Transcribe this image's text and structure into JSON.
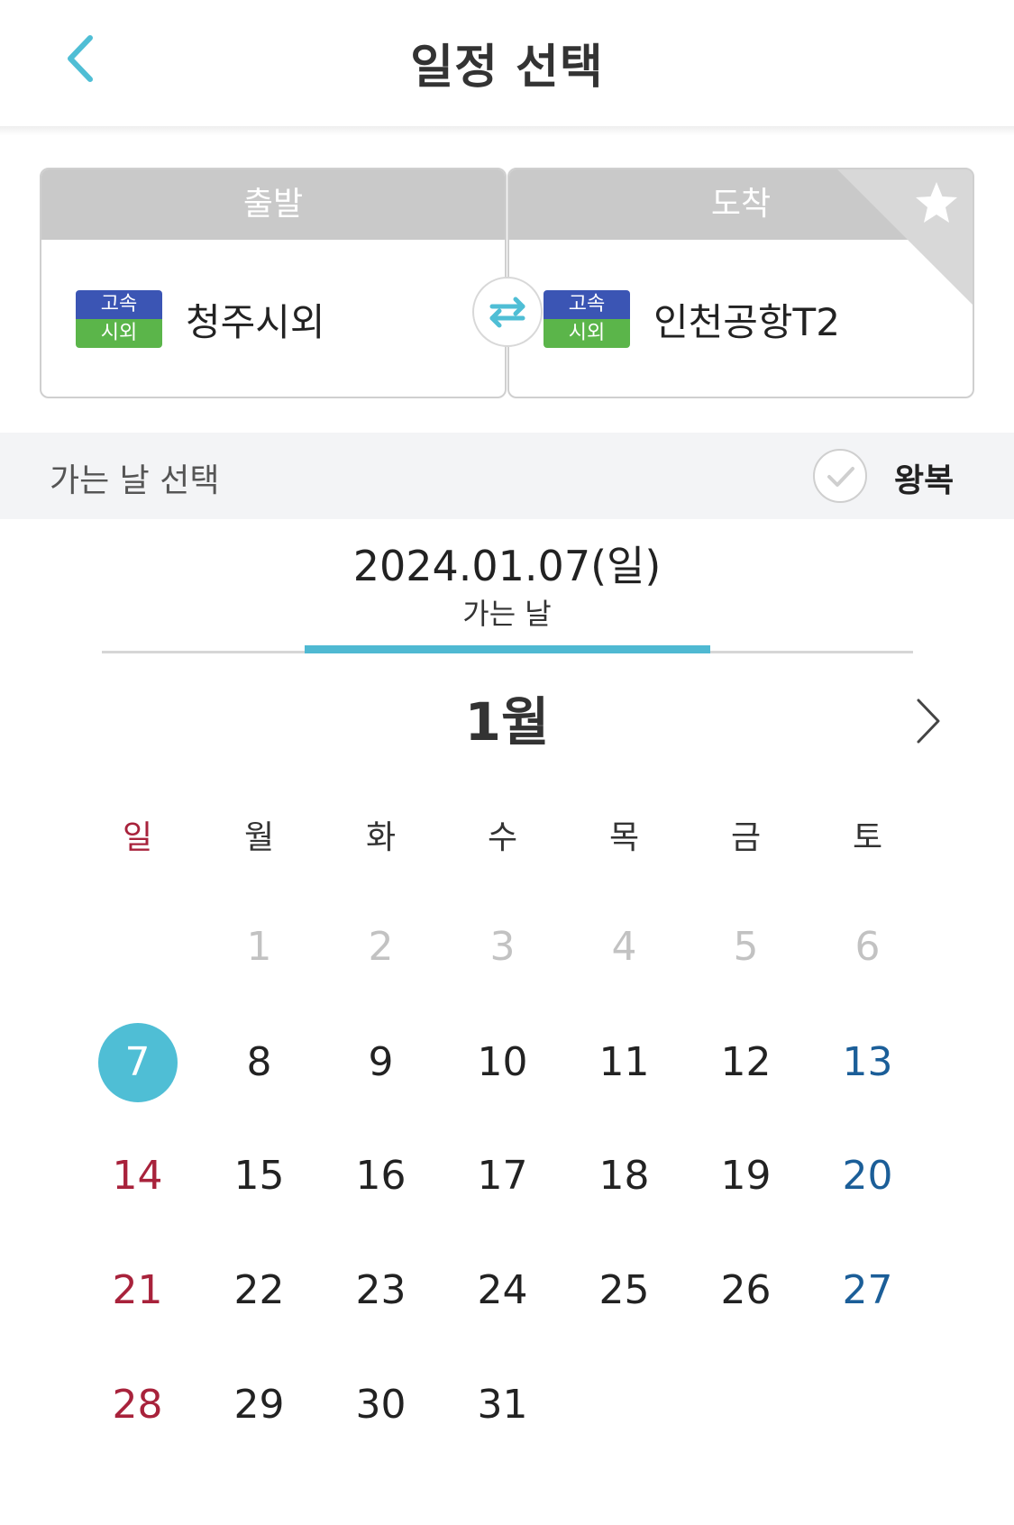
{
  "header": {
    "title": "일정 선택"
  },
  "route": {
    "departure": {
      "label": "출발",
      "badge_top": "고속",
      "badge_bottom": "시외",
      "terminal": "청주시외"
    },
    "arrival": {
      "label": "도착",
      "badge_top": "고속",
      "badge_bottom": "시외",
      "terminal": "인천공항T2"
    }
  },
  "section": {
    "label": "가는 날 선택",
    "round_trip_label": "왕복"
  },
  "selection": {
    "date": "2024.01.07(일)",
    "sub_label": "가는 날"
  },
  "calendar": {
    "month": "1월",
    "weekdays": [
      "일",
      "월",
      "화",
      "수",
      "목",
      "금",
      "토"
    ],
    "weeks": [
      [
        "",
        "1",
        "2",
        "3",
        "4",
        "5",
        "6"
      ],
      [
        "7",
        "8",
        "9",
        "10",
        "11",
        "12",
        "13"
      ],
      [
        "14",
        "15",
        "16",
        "17",
        "18",
        "19",
        "20"
      ],
      [
        "21",
        "22",
        "23",
        "24",
        "25",
        "26",
        "27"
      ],
      [
        "28",
        "29",
        "30",
        "31",
        "",
        "",
        ""
      ]
    ],
    "selected_day": "7"
  },
  "colors": {
    "accent": "#4fbed5",
    "sunday": "#a8223b",
    "saturday": "#1b5e98",
    "past": "#c2c2c2",
    "badge_blue": "#3b55b4",
    "badge_green": "#5bb54a"
  }
}
